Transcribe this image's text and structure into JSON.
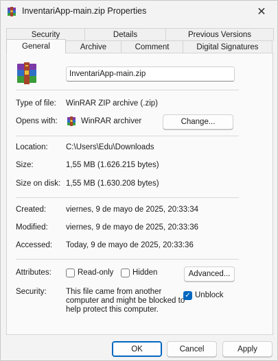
{
  "window": {
    "title": "InventariApp-main.zip Properties",
    "close_glyph": "✕"
  },
  "tabs": {
    "back_row": [
      "Security",
      "Details",
      "Previous Versions"
    ],
    "front_row": [
      "General",
      "Archive",
      "Comment",
      "Digital Signatures"
    ],
    "selected": "General"
  },
  "general": {
    "file_name": "InventariApp-main.zip",
    "type_label": "Type of file:",
    "type_value": "WinRAR ZIP archive (.zip)",
    "opens_label": "Opens with:",
    "opens_value": "WinRAR archiver",
    "change_button": "Change...",
    "location_label": "Location:",
    "location_value": "C:\\Users\\Edu\\Downloads",
    "size_label": "Size:",
    "size_value": "1,55 MB (1.626.215 bytes)",
    "size_on_disk_label": "Size on disk:",
    "size_on_disk_value": "1,55 MB (1.630.208 bytes)",
    "created_label": "Created:",
    "created_value": "viernes, 9 de mayo de 2025, 20:33:34",
    "modified_label": "Modified:",
    "modified_value": "viernes, 9 de mayo de 2025, 20:33:36",
    "accessed_label": "Accessed:",
    "accessed_value": "Today, 9 de mayo de 2025, 20:33:36",
    "attributes_label": "Attributes:",
    "readonly_label": "Read-only",
    "readonly_checked": false,
    "hidden_label": "Hidden",
    "hidden_checked": false,
    "advanced_button": "Advanced...",
    "security_label": "Security:",
    "security_text_1": "This file came from another",
    "security_text_2": "computer and might be blocked to",
    "security_text_3": "help protect this computer.",
    "unblock_label": "Unblock",
    "unblock_checked": true,
    "check_glyph": "✓"
  },
  "footer": {
    "ok": "OK",
    "cancel": "Cancel",
    "apply": "Apply"
  },
  "colors": {
    "accent": "#0067c0",
    "background": "#f3f3f3",
    "panel": "#fafafa"
  },
  "icons": {
    "title": "winrar-icon",
    "file": "winrar-archive-icon",
    "opens_with": "winrar-icon"
  }
}
